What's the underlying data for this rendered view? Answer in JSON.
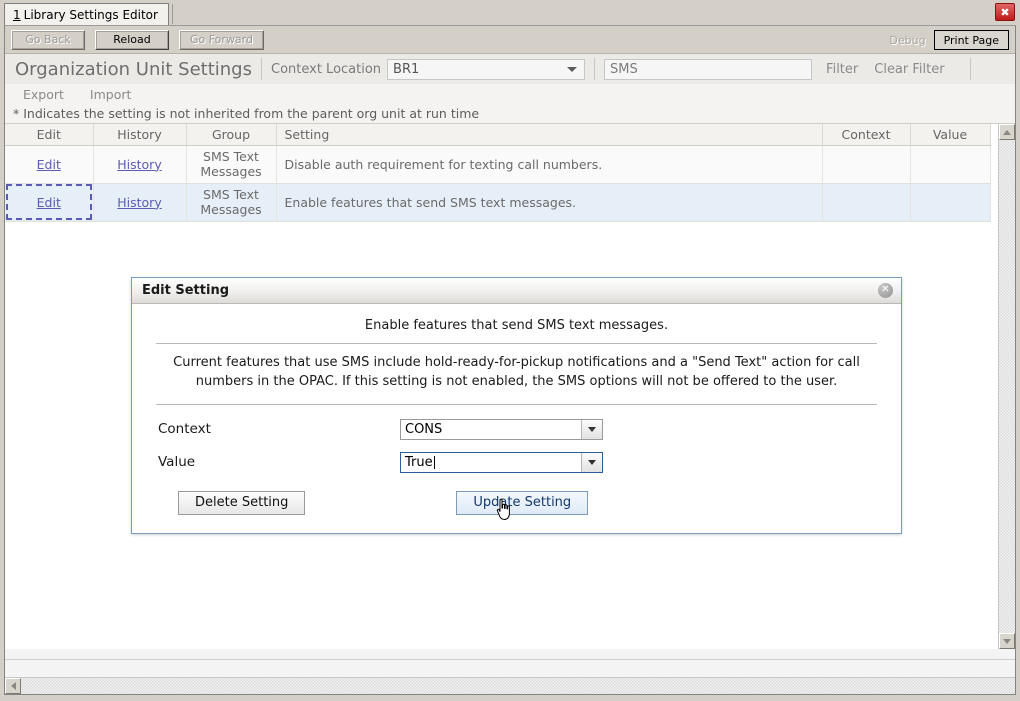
{
  "window": {
    "tab_accel": "1",
    "tab_label": "Library Settings Editor",
    "close_label": "✖"
  },
  "navbar": {
    "back_label": "Go Back",
    "reload_label": "Reload",
    "forward_label": "Go Forward",
    "debug_label": "Debug",
    "print_label": "Print Page"
  },
  "header": {
    "title": "Organization Unit Settings",
    "context_location_label": "Context Location",
    "context_location_value": "BR1",
    "filter_value": "SMS",
    "filter_button": "Filter",
    "clear_filter_button": "Clear Filter"
  },
  "actions": {
    "export_label": "Export",
    "import_label": "Import"
  },
  "note": "* Indicates the setting is not inherited from the parent org unit at run time",
  "table": {
    "columns": [
      "Edit",
      "History",
      "Group",
      "Setting",
      "Context",
      "Value"
    ],
    "rows": [
      {
        "edit": "Edit",
        "history": "History",
        "group": "SMS Text Messages",
        "setting": "Disable auth requirement for texting call numbers.",
        "context": "",
        "value": "",
        "selected": false
      },
      {
        "edit": "Edit",
        "history": "History",
        "group": "SMS Text Messages",
        "setting": "Enable features that send SMS text messages.",
        "context": "",
        "value": "",
        "selected": true
      }
    ]
  },
  "dialog": {
    "title": "Edit Setting",
    "close_label": "✕",
    "setting_name": "Enable features that send SMS text messages.",
    "description": "Current features that use SMS include hold-ready-for-pickup notifications and a \"Send Text\" action for call numbers in the OPAC. If this setting is not enabled, the SMS options will not be offered to the user.",
    "context_label": "Context",
    "context_value": "CONS",
    "value_label": "Value",
    "value_value": "True",
    "delete_button": "Delete Setting",
    "update_button": "Update Setting"
  },
  "colors": {
    "chrome": "#d4d0c8",
    "selected_row": "#e6eff8",
    "link": "#5b5bb5",
    "dialog_border": "#7d9cbb",
    "close_red": "#c01b1b"
  }
}
